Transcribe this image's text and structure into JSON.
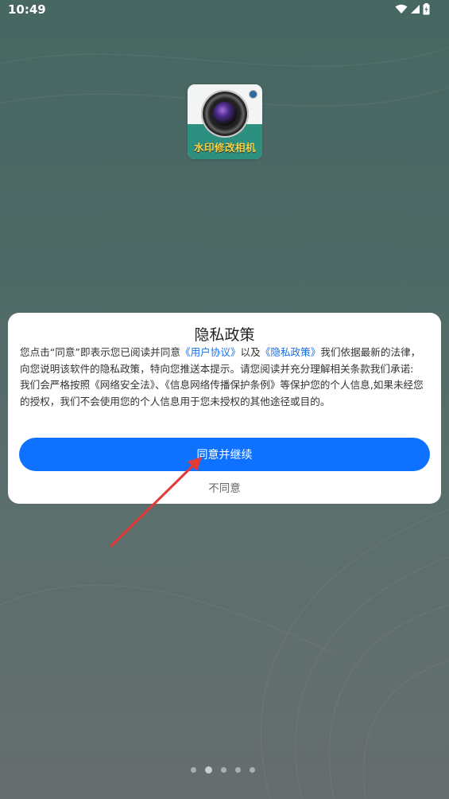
{
  "status_bar": {
    "time": "10:49",
    "icons": [
      "wifi-icon",
      "signal-icon",
      "battery-icon"
    ]
  },
  "app": {
    "icon_label": "水印修改相机"
  },
  "dialog": {
    "title": "隐私政策",
    "body": {
      "part1": "您点击“同意”即表示您已阅读并同意",
      "link_user_agreement": "《用户协议》",
      "part2": "以及",
      "link_privacy_policy": "《隐私政策》",
      "part3": "我们依据最新的法律，向您说明该软件的隐私政策，特向您推送本提示。请您阅读并充分理解相关条款我们承诺:",
      "part4": "我们会严格按照《网络安全法》、《信息网络传播保护条例》等保护您的个人信息,如果未经您的授权，我们不会使用您的个人信息用于您未授权的其他途径或目的。"
    },
    "agree_label": "同意并继续",
    "disagree_label": "不同意"
  },
  "pagination": {
    "count": 5,
    "active_index": 1
  },
  "colors": {
    "primary": "#0f71ff",
    "link": "#1a6fe8",
    "arrow": "#e53935",
    "icon_label": "#f2d349"
  }
}
